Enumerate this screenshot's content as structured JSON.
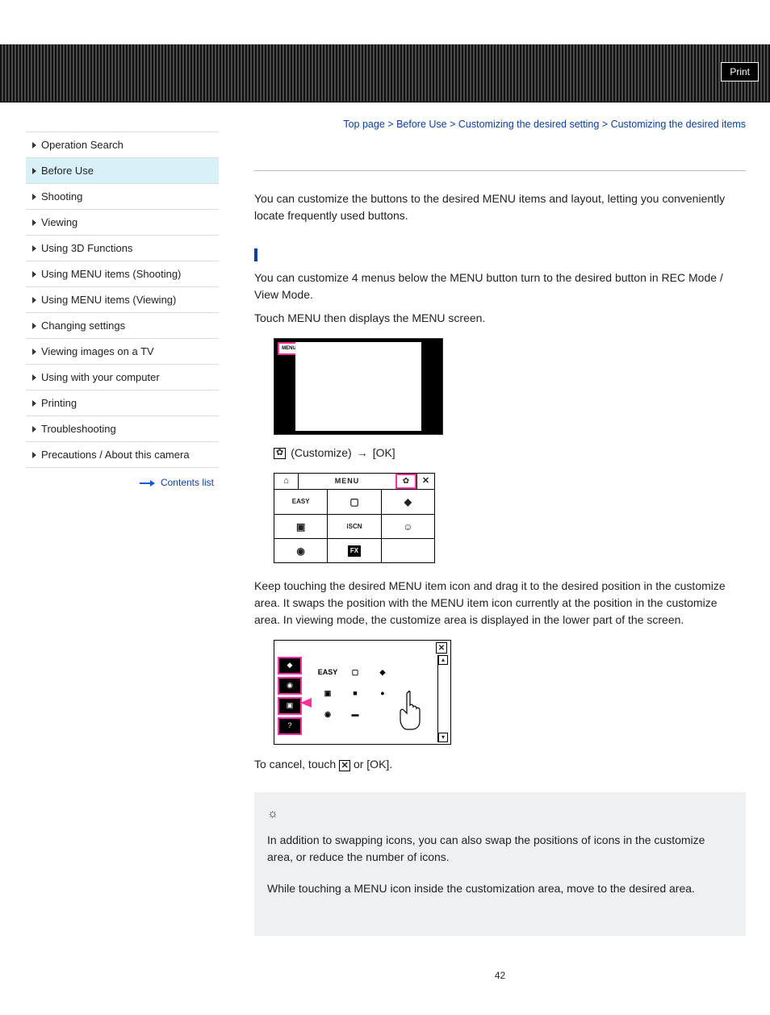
{
  "header": {
    "print": "Print"
  },
  "breadcrumb": {
    "items": [
      "Top page",
      "Before Use",
      "Customizing the desired setting"
    ],
    "current": "Customizing the desired items",
    "sep": ">"
  },
  "sidebar": {
    "items": [
      {
        "label": "Operation Search"
      },
      {
        "label": "Before Use",
        "active": true
      },
      {
        "label": "Shooting"
      },
      {
        "label": "Viewing"
      },
      {
        "label": "Using 3D Functions"
      },
      {
        "label": "Using MENU items (Shooting)"
      },
      {
        "label": "Using MENU items (Viewing)"
      },
      {
        "label": "Changing settings"
      },
      {
        "label": "Viewing images on a TV"
      },
      {
        "label": "Using with your computer"
      },
      {
        "label": "Printing"
      },
      {
        "label": "Troubleshooting"
      },
      {
        "label": "Precautions / About this camera"
      }
    ],
    "contents_link": "Contents list"
  },
  "content": {
    "intro": "You can customize the buttons to the desired MENU items and layout, letting you conveniently locate frequently used buttons.",
    "para2": "You can customize 4 menus below the MENU button turn to the desired button in REC Mode / View Mode.",
    "step_menu": "Touch MENU then displays the MENU screen.",
    "customize_label": "(Customize)",
    "ok_label": "[OK]",
    "drag_para": "Keep touching the desired MENU item icon and drag it to the desired position in the customize area. It swaps the position with the MENU item icon currently at the position in the customize area. In viewing mode, the customize area is displayed in the lower part of the screen.",
    "cancel_pre": "To cancel, touch ",
    "cancel_post": " or [OK].",
    "tip1": "In addition to swapping icons, you can also swap the positions of icons in the customize area, or reduce the number of icons.",
    "tip2": "While touching a MENU icon inside the customization area, move to the desired area."
  },
  "figures": {
    "fig1_menu": "MENU",
    "fig2_header": "MENU",
    "fig2_cells": {
      "r1": [
        "EASY",
        "",
        ""
      ],
      "r2": [
        "",
        "iSCN",
        ""
      ],
      "r3": [
        "",
        "FX",
        ""
      ]
    },
    "fig3_easy": "EASY"
  },
  "icons": {
    "gear": "✿",
    "home": "⌂",
    "close": "✕",
    "bulb": "☼",
    "up": "▴",
    "down": "▾",
    "arrow": "→"
  },
  "page": "42"
}
